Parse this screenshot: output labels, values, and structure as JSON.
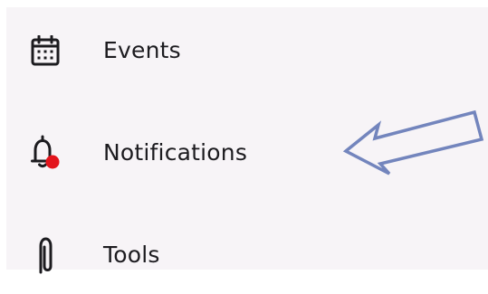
{
  "menu": {
    "items": [
      {
        "label": "Events",
        "icon": "calendar-icon"
      },
      {
        "label": "Notifications",
        "icon": "bell-icon",
        "badge_color": "#e3141c"
      },
      {
        "label": "Tools",
        "icon": "paperclip-icon"
      }
    ]
  },
  "annotation": {
    "arrow_color": "#7385bd",
    "arrow_icon": "left-arrow-icon"
  }
}
